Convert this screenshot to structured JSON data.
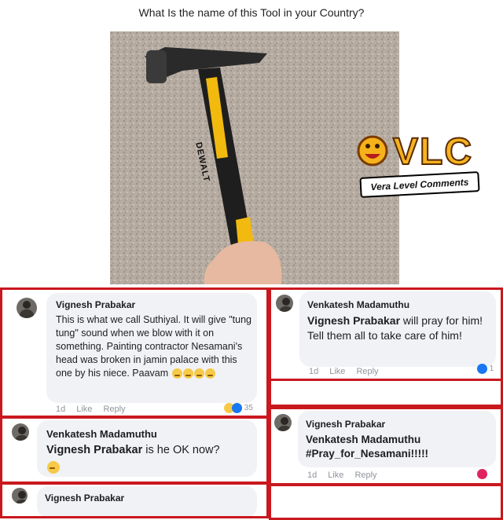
{
  "title": "What Is the name of this Tool in your Country?",
  "photo": {
    "hammer_brand": "DEWALT",
    "logo_text": "VLC",
    "logo_tagline": "Vera Level Comments"
  },
  "comments": [
    {
      "author": "Vignesh Prabakar",
      "text": "This is what we call Suthiyal. It will give \"tung tung\" sound when we blow with it on something. Painting contractor Nesamani's head was broken in jamin palace with this one by his niece. Paavam",
      "time": "1d",
      "like": "Like",
      "reply": "Reply",
      "reaction_count": "35"
    },
    {
      "author": "Venkatesh Madamuthu",
      "mention": "Vignesh Prabakar",
      "text": "will pray for him! Tell them all to take care of him!",
      "time": "1d",
      "like": "Like",
      "reply": "Reply",
      "reaction_count": "1"
    },
    {
      "author": "Venkatesh Madamuthu",
      "mention": "Vignesh Prabakar",
      "text": "is he OK now?"
    },
    {
      "author": "Vignesh Prabakar",
      "mention": "Venkatesh Madamuthu",
      "text": "#Pray_for_Nesamani!!!!!",
      "time": "1d",
      "like": "Like",
      "reply": "Reply"
    },
    {
      "author": "Vignesh Prabakar"
    }
  ]
}
